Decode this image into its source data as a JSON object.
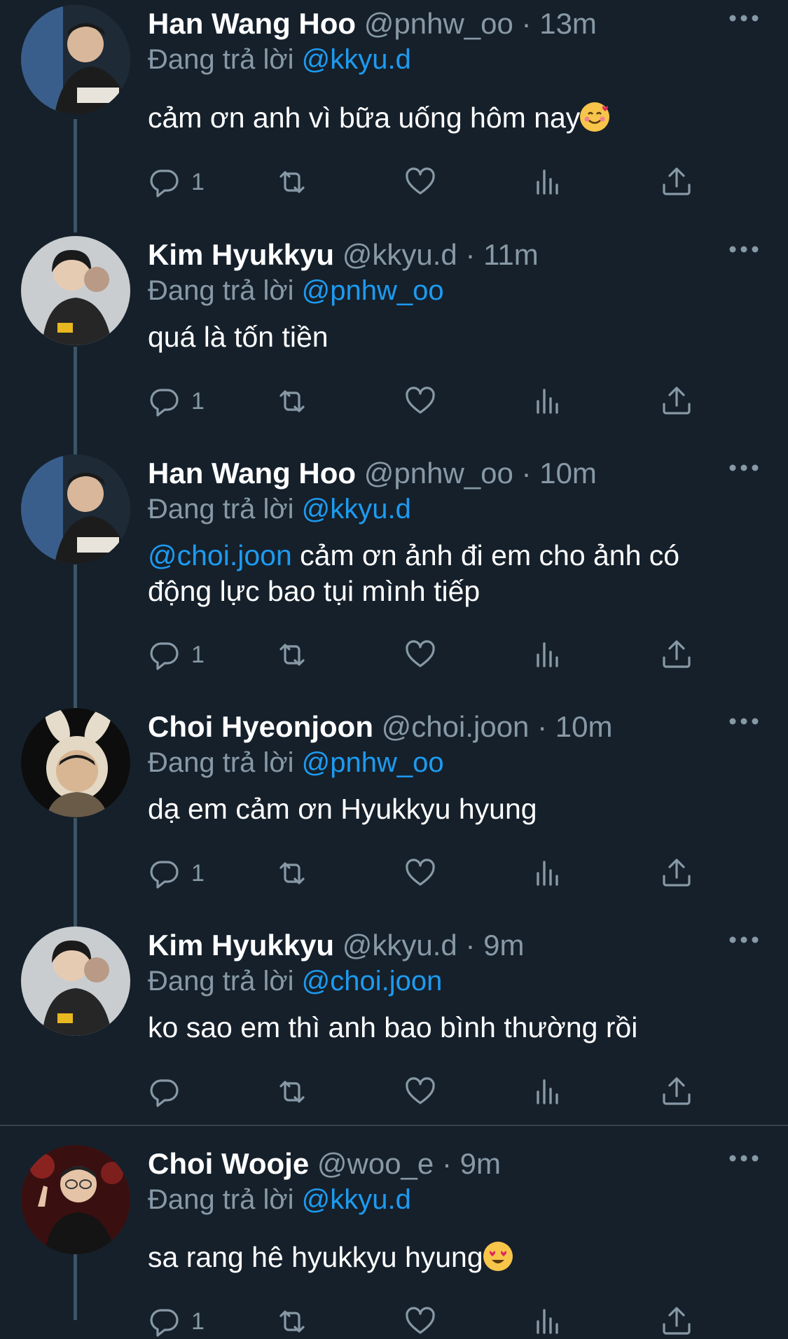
{
  "colors": {
    "background": "#15202b",
    "name": "#ffffff",
    "meta": "#8899a6",
    "mention": "#1d9bf0",
    "thread_line": "#3d5466"
  },
  "icons": {
    "more": "more-horizontal-icon",
    "reply": "reply-icon",
    "retweet": "retweet-icon",
    "like": "heart-icon",
    "views": "bar-chart-icon",
    "share": "share-icon"
  },
  "replying_label": "Đang trả lời",
  "tweets": [
    {
      "name": "Han Wang Hoo",
      "handle": "@pnhw_oo",
      "time": "13m",
      "replying_to": "@kkyu.d",
      "text": "cảm ơn anh vì bữa uống hôm nay",
      "emoji": "smiling-face-with-hearts",
      "reply_count": "1"
    },
    {
      "name": "Kim Hyukkyu",
      "handle": "@kkyu.d",
      "time": "11m",
      "replying_to": "@pnhw_oo",
      "text": "quá là tốn tiền",
      "reply_count": "1"
    },
    {
      "name": "Han Wang Hoo",
      "handle": "@pnhw_oo",
      "time": "10m",
      "replying_to": "@kkyu.d",
      "text_mention": "@choi.joon",
      "text": " cảm ơn ảnh đi em cho ảnh có động lực bao tụi mình tiếp",
      "reply_count": "1"
    },
    {
      "name": "Choi Hyeonjoon",
      "handle": "@choi.joon",
      "time": "10m",
      "replying_to": "@pnhw_oo",
      "text": "dạ em cảm ơn Hyukkyu hyung",
      "reply_count": "1"
    },
    {
      "name": "Kim Hyukkyu",
      "handle": "@kkyu.d",
      "time": "9m",
      "replying_to": "@choi.joon",
      "text": "ko sao em thì anh bao bình thường rồi",
      "reply_count": ""
    },
    {
      "name": "Choi Wooje",
      "handle": "@woo_e",
      "time": "9m",
      "replying_to": "@kkyu.d",
      "text": "sa rang hê hyukkyu hyung",
      "emoji": "heart-eyes",
      "reply_count": "1"
    }
  ],
  "separator": "·"
}
